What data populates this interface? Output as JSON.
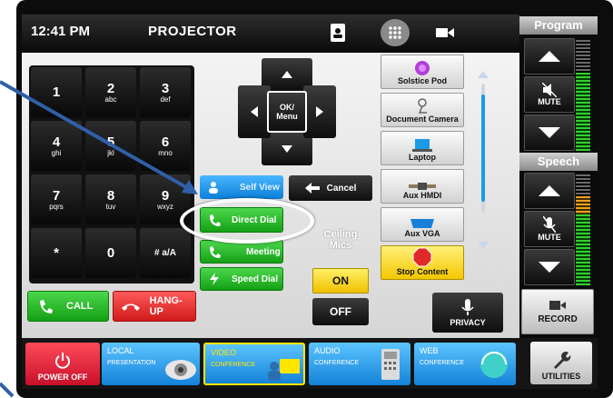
{
  "header": {
    "time": "12:41 PM",
    "title": "PROJECTOR"
  },
  "keypad": {
    "keys": [
      {
        "digit": "1",
        "letters": ""
      },
      {
        "digit": "2",
        "letters": "abc"
      },
      {
        "digit": "3",
        "letters": "def"
      },
      {
        "digit": "4",
        "letters": "ghi"
      },
      {
        "digit": "5",
        "letters": "jkl"
      },
      {
        "digit": "6",
        "letters": "mno"
      },
      {
        "digit": "7",
        "letters": "pqrs"
      },
      {
        "digit": "8",
        "letters": "tuv"
      },
      {
        "digit": "9",
        "letters": "wxyz"
      },
      {
        "digit": "*",
        "letters": ""
      },
      {
        "digit": "0",
        "letters": ""
      },
      {
        "digit": "# a/A",
        "letters": ""
      }
    ],
    "call_label": "CALL",
    "hangup_label": "HANG-UP"
  },
  "dpad": {
    "center_label": "OK/ Menu"
  },
  "menu": {
    "self_view": "Self View",
    "direct_dial": "Direct Dial",
    "meeting": "Meeting",
    "speed_dial": "Speed Dial",
    "cancel": "Cancel"
  },
  "ceiling_mics": {
    "label": "Ceiling Mics",
    "on": "ON",
    "off": "OFF"
  },
  "sources": [
    {
      "label": "Solstice Pod",
      "icon": "solstice-icon"
    },
    {
      "label": "Document Camera",
      "icon": "document-camera-icon"
    },
    {
      "label": "Laptop",
      "icon": "laptop-icon"
    },
    {
      "label": "Aux HMDI",
      "icon": "hdmi-icon"
    },
    {
      "label": "Aux VGA",
      "icon": "vga-icon"
    },
    {
      "label": "Stop Content",
      "icon": "stop-icon"
    }
  ],
  "privacy_label": "PRIVACY",
  "volume": {
    "program_label": "Program",
    "speech_label": "Speech",
    "mute_label": "MUTE",
    "record_label": "RECORD"
  },
  "bottom_nav": {
    "power_off": "POWER OFF",
    "local_title": "LOCAL",
    "local_sub": "PRESENTATION",
    "video_title": "VIDEO",
    "video_sub": "CONFERENCE",
    "audio_title": "AUDIO",
    "audio_sub": "CONFERENCE",
    "web_title": "WEB",
    "web_sub": "CONFERENCE",
    "utilities": "UTILITIES"
  },
  "colors": {
    "accent_blue": "#1a9be8",
    "green": "#22b822",
    "red": "#e02a2a",
    "yellow": "#ffd21e"
  }
}
